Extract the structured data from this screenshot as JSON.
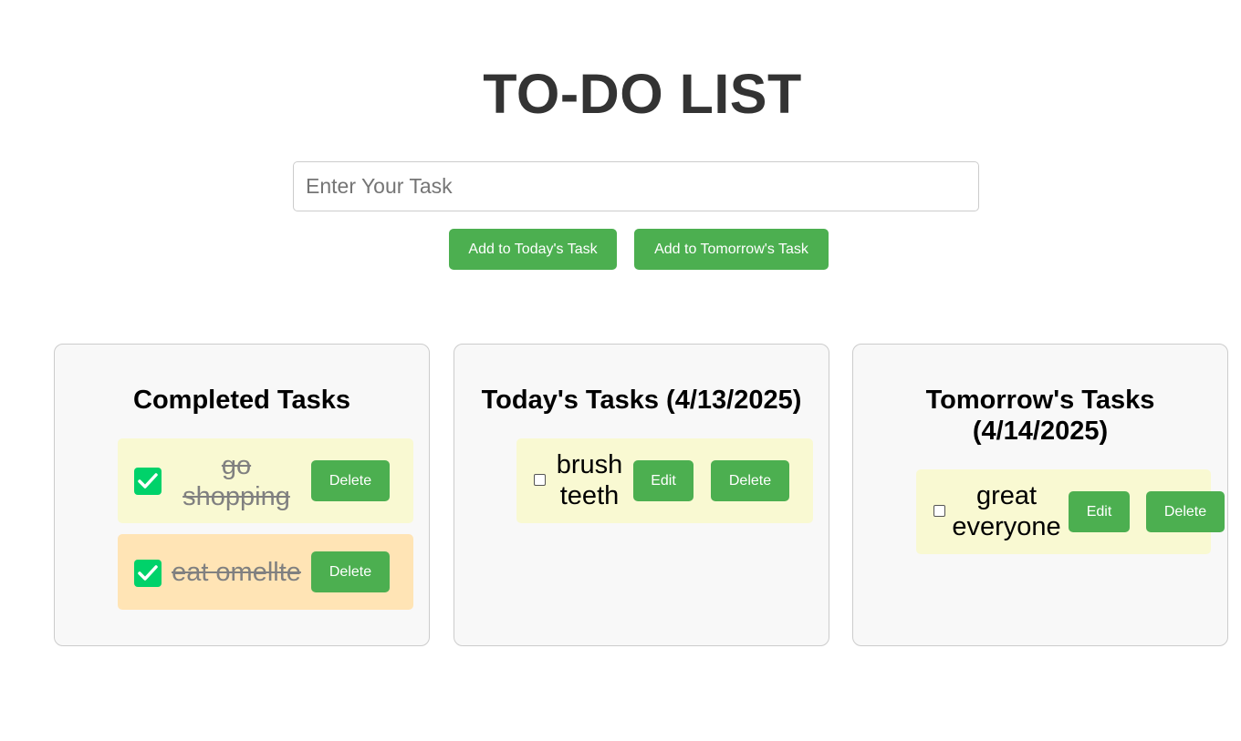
{
  "header": {
    "title": "TO-DO LIST"
  },
  "input": {
    "placeholder": "Enter Your Task",
    "value": ""
  },
  "buttons": {
    "add_today": "Add to Today's Task",
    "add_tomorrow": "Add to Tomorrow's Task"
  },
  "panels": {
    "completed": {
      "title": "Completed Tasks",
      "items": [
        {
          "text": "go shopping",
          "checked": true,
          "delete_label": "Delete"
        },
        {
          "text": "eat omellte",
          "checked": true,
          "delete_label": "Delete"
        }
      ]
    },
    "today": {
      "title": "Today's Tasks (4/13/2025)",
      "items": [
        {
          "text": "brush teeth",
          "checked": false,
          "edit_label": "Edit",
          "delete_label": "Delete"
        }
      ]
    },
    "tomorrow": {
      "title": "Tomorrow's Tasks (4/14/2025)",
      "items": [
        {
          "text": "great everyone",
          "checked": false,
          "edit_label": "Edit",
          "delete_label": "Delete"
        }
      ]
    }
  },
  "colors": {
    "accent_green": "#4caf50",
    "check_green": "#00d26a",
    "item_yellow": "#f9f9d2",
    "item_orange": "#ffe4b5",
    "panel_bg": "#f8f8f8"
  }
}
